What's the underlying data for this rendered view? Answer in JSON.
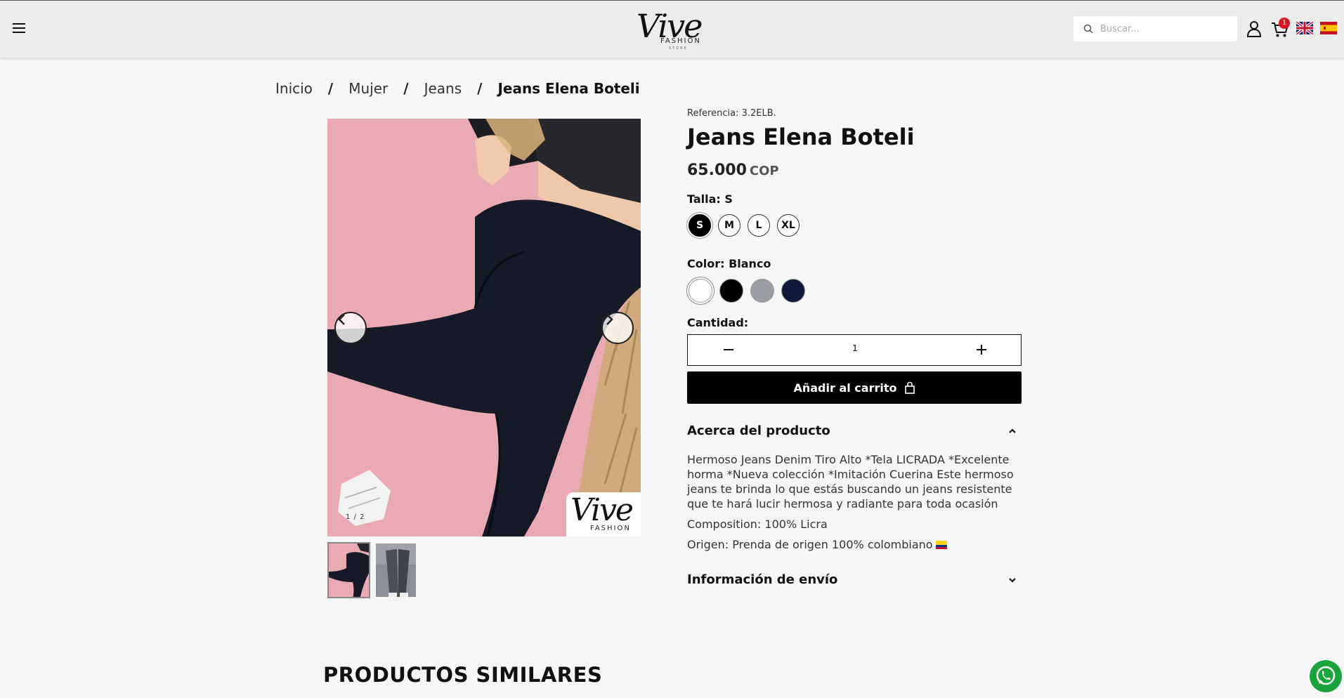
{
  "header": {
    "logo": {
      "script": "Vive",
      "sub": "FASHION",
      "sub2": "STORE"
    },
    "search_placeholder": "Buscar...",
    "cart_count": "1"
  },
  "breadcrumb": {
    "items": [
      "Inicio",
      "Mujer",
      "Jeans"
    ],
    "current": "Jeans Elena Boteli",
    "separator": "/"
  },
  "gallery": {
    "counter": "1 / 2",
    "watermark_script": "Vive",
    "watermark_sub": "FASHION",
    "thumbnails": [
      "thumbnail-1",
      "thumbnail-2"
    ],
    "background_color": "#e7a7b0"
  },
  "product": {
    "reference_label": "Referencia:",
    "reference": "3.2ELB.",
    "title": "Jeans Elena Boteli",
    "price": "65.000",
    "currency": "COP",
    "size_label": "Talla:",
    "size_value": "S",
    "sizes": [
      "S",
      "M",
      "L",
      "XL"
    ],
    "color_label": "Color:",
    "color_value": "Blanco",
    "colors": [
      "#ffffff",
      "#000000",
      "#9a9ca3",
      "#0e1a3a"
    ],
    "quantity_label": "Cantidad:",
    "quantity": "1",
    "add_to_cart": "Añadir al carrito",
    "about_title": "Acerca del producto",
    "description": "Hermoso Jeans Denim Tiro Alto *Tela LICRADA *Excelente horma *Nueva colección *Imitación Cuerina Este hermoso jeans te brinda lo que estás buscando un jeans resistente que te hará lucir hermosa y radiante para toda ocasión",
    "composition": "Composition: 100% Licra",
    "origin": "Origen: Prenda de origen 100% colombiano",
    "shipping_title": "Información de envío"
  },
  "similar_title": "PRODUCTOS SIMILARES",
  "colors": {
    "accent": "#000000",
    "badge": "#e0141e",
    "whatsapp": "#1aa53c"
  }
}
